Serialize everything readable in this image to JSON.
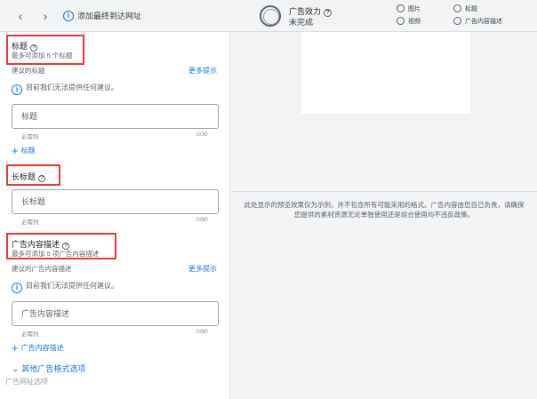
{
  "topbar": {
    "back_icon": "chevron-left-icon",
    "forward_icon": "chevron-right-icon",
    "final_url_label": "添加最终到达网址",
    "strength_title": "广告效力",
    "strength_status": "未完成",
    "checklist": [
      {
        "label": "图片"
      },
      {
        "label": "标题"
      },
      {
        "label": "视频"
      },
      {
        "label": "广告内容描述"
      }
    ]
  },
  "headlines": {
    "title": "标题",
    "subtitle": "最多可添加 5 个标题",
    "suggested_label": "建议的标题",
    "more_tips": "更多提示",
    "no_suggestion": "目前我们无法提供任何建议。",
    "input_placeholder": "标题",
    "required_hint": "必需列",
    "counter": "0/30",
    "add_label": "标题"
  },
  "long_headline": {
    "title": "长标题",
    "input_placeholder": "长标题",
    "required_hint": "必需列",
    "counter": "0/90"
  },
  "descriptions": {
    "title": "广告内容描述",
    "subtitle": "最多可添加 5 项广告内容描述",
    "suggested_label": "建议的广告内容描述",
    "more_tips": "更多提示",
    "no_suggestion": "目前我们无法提供任何建议。",
    "input_placeholder": "广告内容描述",
    "required_hint": "必需列",
    "counter": "0/90",
    "add_label": "广告内容描述"
  },
  "more_formats": "其他广告格式选项",
  "watermark": "广告网址选项",
  "preview": {
    "disclaimer": "此处显示的预览效果仅为示例，并不包含所有可能采用的格式。广告内容由您自己负责，请确保您提供的素材资源无论单独使用还是组合使用均不违反政策。"
  },
  "colors": {
    "accent": "#1a73e8",
    "highlight_box": "#e53935",
    "preview_bg": "#f1f3f4"
  }
}
